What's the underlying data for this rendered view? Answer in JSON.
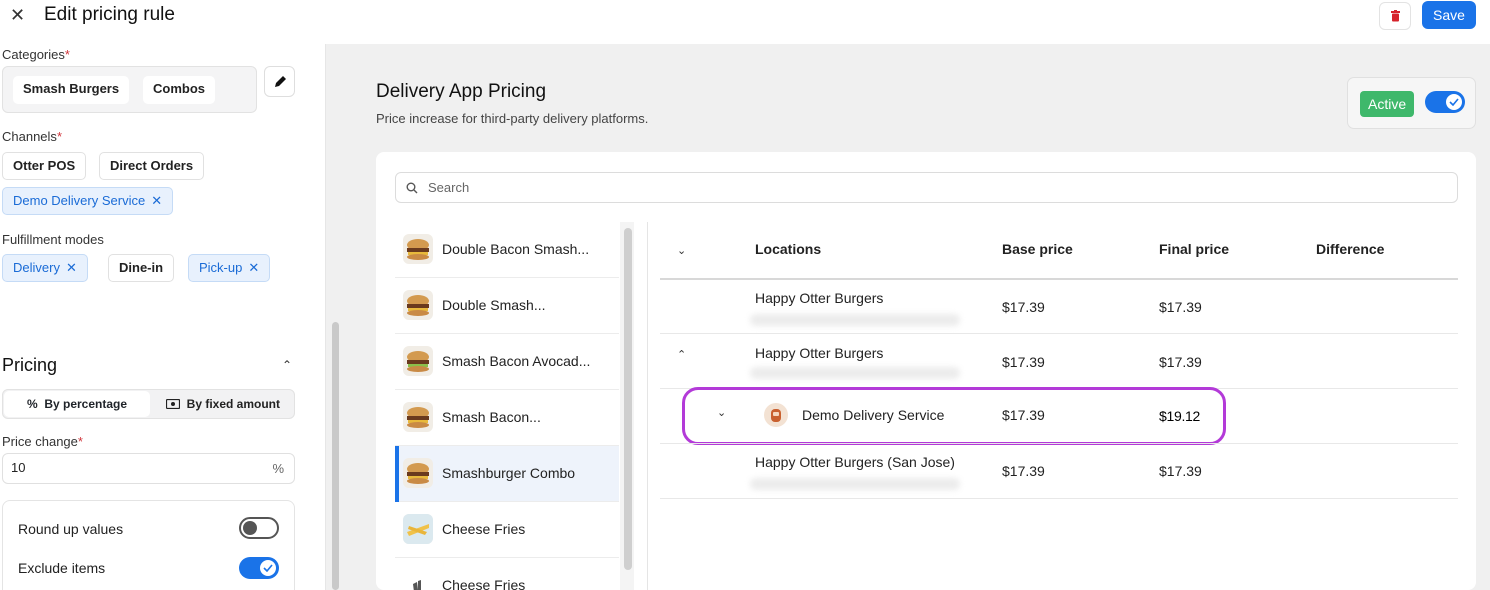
{
  "header": {
    "close_icon": "close-icon",
    "title": "Edit pricing rule",
    "save_label": "Save",
    "delete_icon": "trash-icon"
  },
  "left": {
    "categories_label": "Categories",
    "categories": [
      "Smash Burgers",
      "Combos"
    ],
    "channels_label": "Channels",
    "channels": [
      "Otter POS",
      "Direct Orders"
    ],
    "channels_selected": [
      "Demo Delivery Service"
    ],
    "fulfillment_label": "Fulfillment modes",
    "fulfillment": [
      {
        "label": "Delivery",
        "selected": true
      },
      {
        "label": "Dine-in",
        "selected": false
      },
      {
        "label": "Pick-up",
        "selected": true
      }
    ],
    "pricing_title": "Pricing",
    "by_percentage": "By percentage",
    "by_fixed_amount": "By fixed amount",
    "price_change_label": "Price change",
    "price_change_value": "10",
    "price_change_unit": "%",
    "round_up_label": "Round up values",
    "round_up": false,
    "exclude_items_label": "Exclude items",
    "exclude_items": true,
    "required_mark": "*",
    "remove_mark": "✕",
    "percent_glyph": "%"
  },
  "right": {
    "title": "Delivery App Pricing",
    "subtitle": "Price increase for third-party delivery platforms.",
    "active_label": "Active",
    "active": true,
    "search_placeholder": "Search",
    "items": [
      "Double Bacon Smash...",
      "Double Smash...",
      "Smash Bacon Avocad...",
      "Smash Bacon...",
      "Smashburger Combo",
      "Cheese Fries",
      "Cheese Fries"
    ],
    "selected_item": "Smashburger Combo",
    "columns": [
      "Locations",
      "Base price",
      "Final price",
      "Difference"
    ],
    "rows": [
      {
        "location": "Happy Otter Burgers",
        "base": "$17.39",
        "final": "$17.39"
      },
      {
        "location": "Happy Otter Burgers",
        "base": "$17.39",
        "final": "$17.39"
      },
      {
        "location": "Demo Delivery Service",
        "base": "$17.39",
        "final": "$19.12"
      },
      {
        "location": "Happy Otter Burgers (San Jose)",
        "base": "$17.39",
        "final": "$17.39"
      }
    ]
  },
  "colors": {
    "accent": "#1a73e8",
    "active_green": "#3fb86b",
    "highlight": "#b33ad8",
    "required_red": "#d0343a"
  }
}
